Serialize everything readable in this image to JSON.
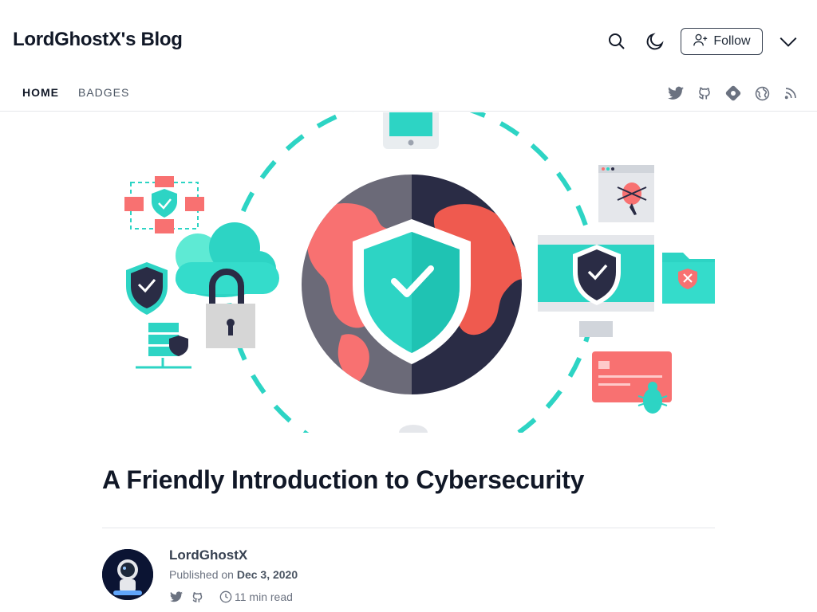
{
  "header": {
    "blog_title": "LordGhostX's Blog",
    "follow_label": "Follow"
  },
  "nav": {
    "items": [
      {
        "label": "HOME",
        "active": true
      },
      {
        "label": "BADGES",
        "active": false
      }
    ]
  },
  "social_icons": [
    "twitter-icon",
    "github-icon",
    "hashnode-icon",
    "globe-icon",
    "rss-icon"
  ],
  "colors": {
    "accent_teal": "#2dd4c4",
    "red": "#f87171",
    "dark_navy": "#2a2e45",
    "text_dark": "#111827"
  },
  "article": {
    "title": "A Friendly Introduction to Cybersecurity",
    "author": "LordGhostX",
    "published_prefix": "Published on",
    "published_date": "Dec 3, 2020",
    "read_time": "11 min read"
  }
}
